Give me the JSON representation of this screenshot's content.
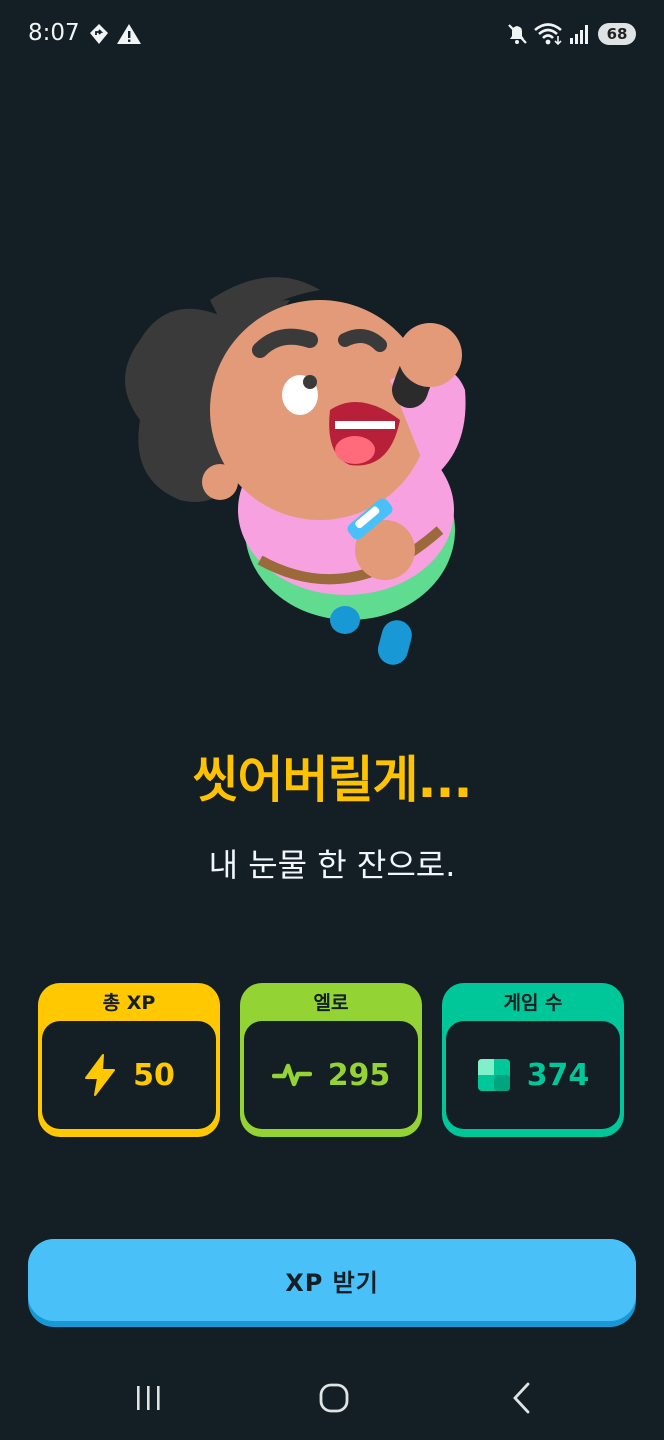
{
  "status_bar": {
    "time": "8:07",
    "battery": "68",
    "icons": [
      "navigation-diamond-icon",
      "warning-icon",
      "mute-icon",
      "wifi-icon",
      "signal-icon",
      "battery-icon"
    ]
  },
  "result": {
    "title": "씻어버릴게...",
    "subtitle": "내 눈물 한 잔으로."
  },
  "stats": {
    "xp": {
      "label": "총 XP",
      "value": "50",
      "icon": "lightning-icon",
      "color": "#ffc800"
    },
    "elo": {
      "label": "엘로",
      "value": "295",
      "icon": "pulse-icon",
      "color": "#93d333"
    },
    "games": {
      "label": "게임 수",
      "value": "374",
      "icon": "square-icon",
      "color": "#00c79a"
    }
  },
  "cta": {
    "label": "XP 받기",
    "color": "#49c0f8"
  },
  "nav": {
    "icons": [
      "recent-apps-icon",
      "home-icon",
      "back-icon"
    ]
  },
  "colors": {
    "background": "#131f24",
    "title": "#ffc200"
  }
}
